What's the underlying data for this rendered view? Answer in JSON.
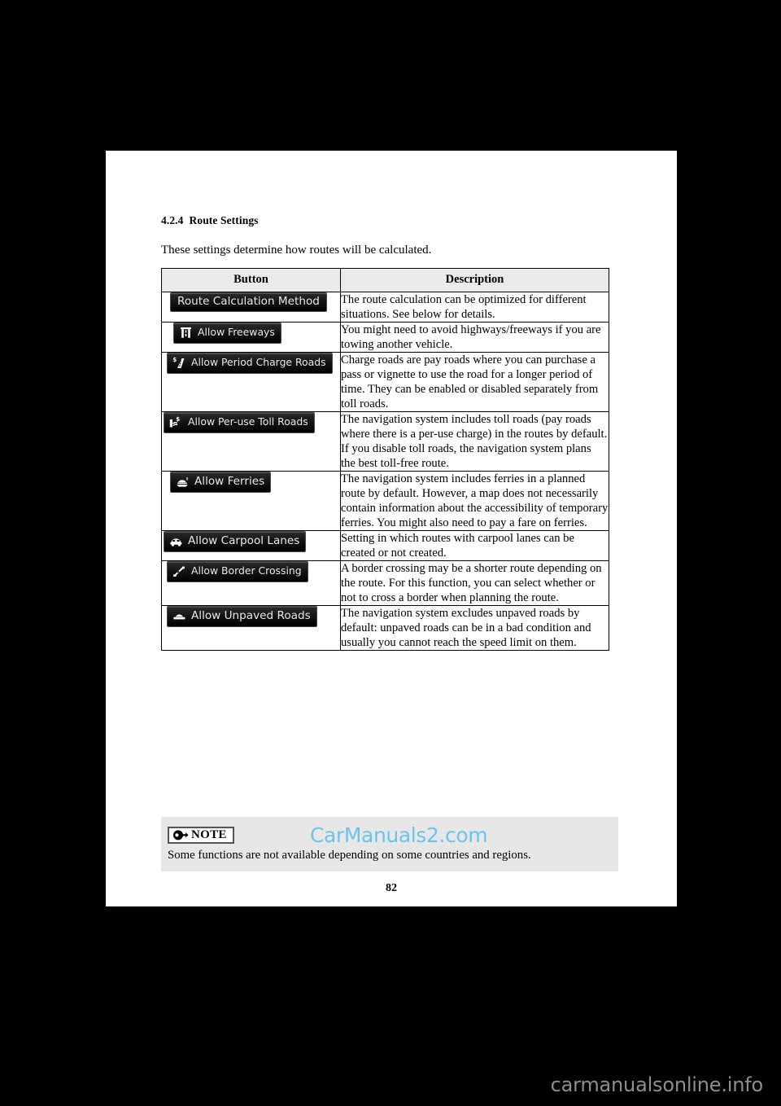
{
  "document": {
    "page_number": "82",
    "section_number": "4.2.4",
    "section_title": "Route Settings",
    "intro": "These settings determine how routes will be calculated."
  },
  "table": {
    "headers": {
      "button": "Button",
      "description": "Description"
    },
    "rows": [
      {
        "icon": "none",
        "label": "Route Calculation Method",
        "description": "The route calculation can be optimized for different situations. See below for details."
      },
      {
        "icon": "freeway-icon",
        "label": "Allow Freeways",
        "description": "You might need to avoid highways/freeways if you are towing another vehicle."
      },
      {
        "icon": "period-charge-road-icon",
        "label": "Allow Period Charge Roads",
        "description": "Charge roads are pay roads where you can purchase a pass or vignette to use the road for a longer period of time. They can be enabled or disabled separately from toll roads."
      },
      {
        "icon": "toll-booth-icon",
        "label": "Allow Per-use Toll Roads",
        "description": "The navigation system includes toll roads (pay roads where there is a per-use charge) in the routes by default. If you disable toll roads, the navigation system plans the best toll-free route."
      },
      {
        "icon": "ferry-icon",
        "label": "Allow Ferries",
        "description": "The navigation system includes ferries in a planned route by default. However, a map does not necessarily contain information about the accessibility of temporary ferries. You might also need to pay a fare on ferries."
      },
      {
        "icon": "carpool-car-icon",
        "label": "Allow Carpool Lanes",
        "description": "Setting in which routes with carpool lanes can be created or not created."
      },
      {
        "icon": "border-crossing-icon",
        "label": "Allow Border Crossing",
        "description": "A border crossing may be a shorter route depending on the route. For this function, you can select whether or not to cross a border when planning the route."
      },
      {
        "icon": "unpaved-road-icon",
        "label": "Allow Unpaved Roads",
        "description": "The navigation system excludes unpaved roads by default: unpaved roads can be in a bad condition and usually you cannot reach the speed limit on them."
      }
    ]
  },
  "note": {
    "badge_label": "NOTE",
    "text": "Some functions are not available depending on some countries and regions."
  },
  "watermarks": {
    "inline": "CarManuals2.com",
    "bottom": "carmanualsonline.info"
  },
  "colors": {
    "watermark_inline": "#6cc3ec",
    "watermark_bottom": "#8e8e8e",
    "table_header_bg": "#eaeaea",
    "note_bg": "#e7e7e7",
    "button_bg": "#141414"
  }
}
